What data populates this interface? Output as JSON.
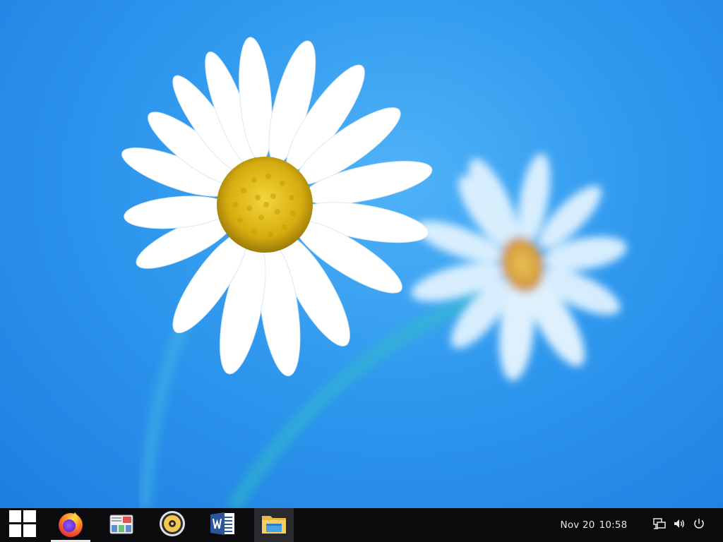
{
  "desktop": {
    "wallpaper": "daisy-wallpaper",
    "colors": {
      "sky": "#2f98ee",
      "petal": "#ffffff",
      "center": "#e7c21a",
      "stem": "#3fb7d6"
    }
  },
  "taskbar": {
    "start_icon": "windows-logo-icon",
    "apps": [
      {
        "icon": "firefox-icon"
      },
      {
        "icon": "mail-icon"
      },
      {
        "icon": "music-player-icon"
      },
      {
        "icon": "word-icon"
      },
      {
        "icon": "file-explorer-icon"
      }
    ],
    "date": "Nov 20",
    "time": "10:58",
    "tray": [
      "network-icon",
      "volume-icon",
      "power-icon"
    ],
    "colors": {
      "background": "#0b0b0d",
      "active": "#2a2a2e",
      "text": "#e6e6e6"
    }
  }
}
